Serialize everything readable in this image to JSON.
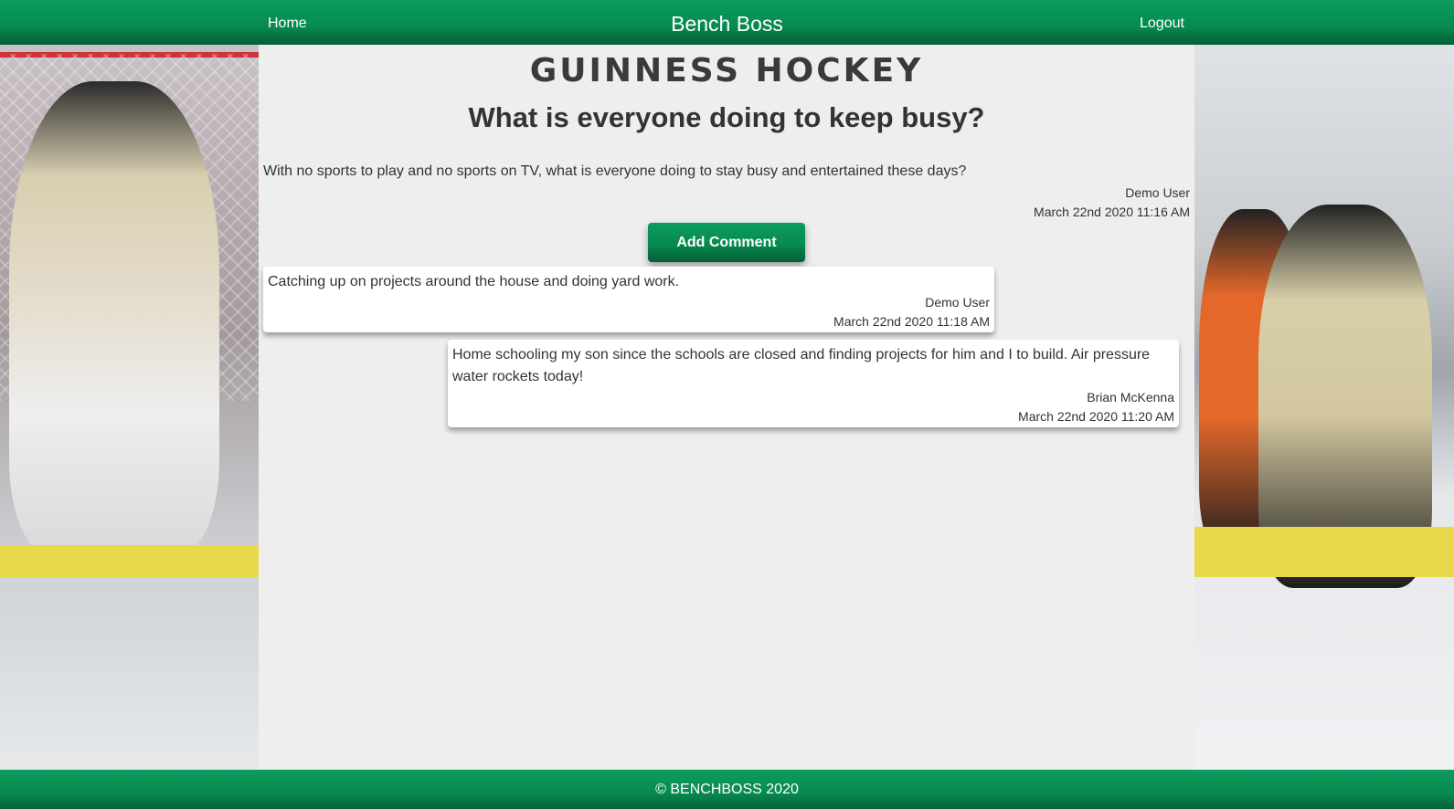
{
  "nav": {
    "home_label": "Home",
    "brand": "Bench Boss",
    "logout_label": "Logout"
  },
  "team": {
    "name": "GUINNESS HOCKEY"
  },
  "post": {
    "title": "What is everyone doing to keep busy?",
    "body": "With no sports to play and no sports on TV, what is everyone doing to stay busy and entertained these days?",
    "author": "Demo User",
    "date": "March 22nd 2020 11:16 AM"
  },
  "actions": {
    "add_comment_label": "Add Comment"
  },
  "comments": [
    {
      "text": "Catching up on projects around the house and doing yard work.",
      "author": "Demo User",
      "date": "March 22nd 2020 11:18 AM"
    },
    {
      "text": "Home schooling my son since the schools are closed and finding projects for him and I to build. Air pressure water rockets today!",
      "author": "Brian McKenna",
      "date": "March 22nd 2020 11:20 AM"
    }
  ],
  "footer": {
    "copyright": "© BENCHBOSS 2020"
  },
  "colors": {
    "brand_green": "#078a4f",
    "brand_green_dark": "#045f36",
    "content_bg": "#eeeeee",
    "text": "#333333"
  }
}
